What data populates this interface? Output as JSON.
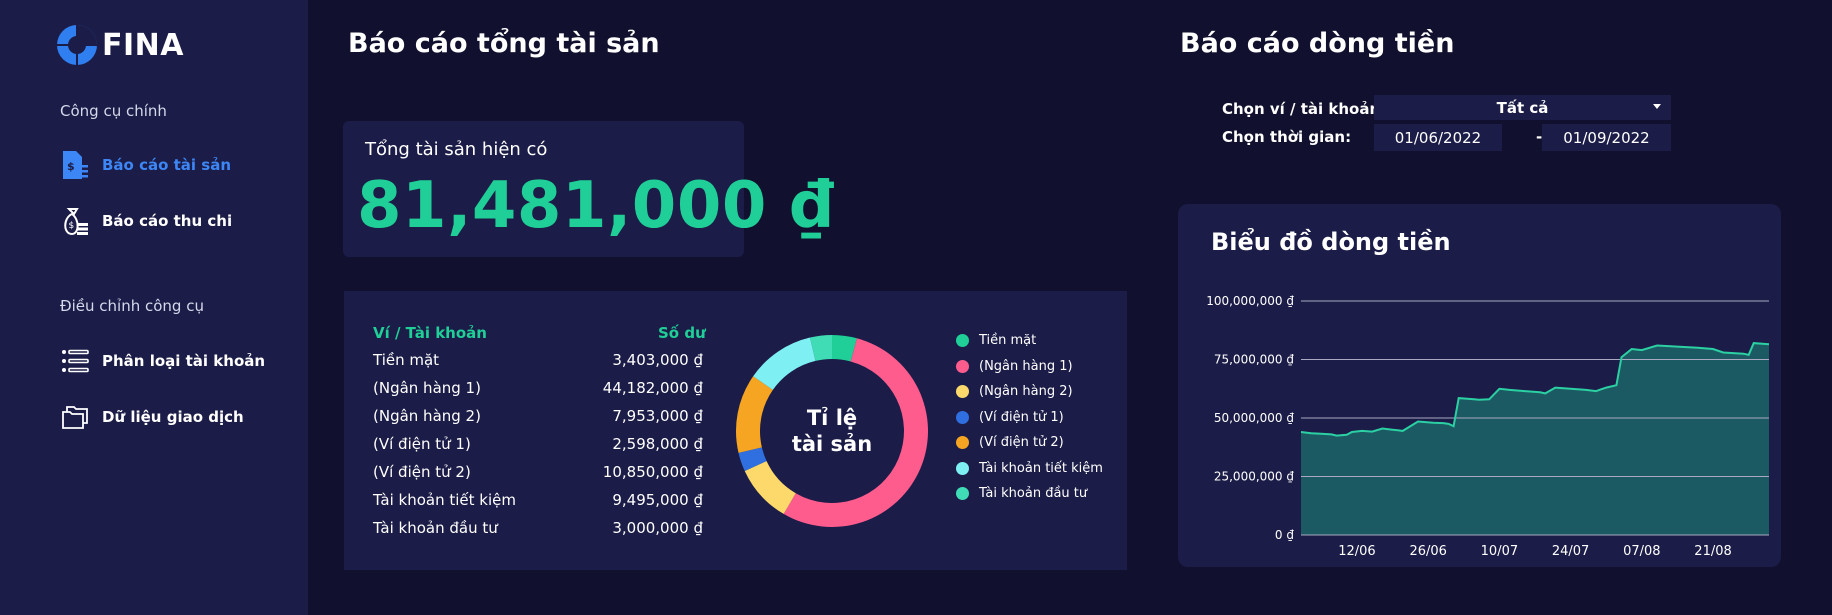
{
  "brand": {
    "name": "FINA",
    "logo_icon": "fina-logo-icon"
  },
  "sidebar": {
    "section_main": "Công cụ chính",
    "section_tools": "Điều chỉnh công cụ",
    "items": [
      {
        "label": "Báo cáo tài sản",
        "icon": "asset-report-icon",
        "active": true
      },
      {
        "label": "Báo cáo thu chi",
        "icon": "money-bag-icon",
        "active": false
      },
      {
        "label": "Phân loại tài khoản",
        "icon": "list-icon",
        "active": false
      },
      {
        "label": "Dữ liệu giao dịch",
        "icon": "folders-icon",
        "active": false
      }
    ]
  },
  "assets": {
    "title": "Báo cáo tổng tài sản",
    "total_label": "Tổng tài sản hiện có",
    "total_value": "81,481,000 ₫",
    "table": {
      "col_account": "Ví / Tài khoản",
      "col_balance": "Số dư",
      "rows": [
        {
          "name": "Tiền mặt",
          "balance": "3,403,000 ₫"
        },
        {
          "name": "(Ngân hàng 1)",
          "balance": "44,182,000 ₫"
        },
        {
          "name": "(Ngân hàng 2)",
          "balance": "7,953,000 ₫"
        },
        {
          "name": "(Ví điện tử 1)",
          "balance": "2,598,000 ₫"
        },
        {
          "name": "(Ví điện tử 2)",
          "balance": "10,850,000 ₫"
        },
        {
          "name": "Tài khoản tiết kiệm",
          "balance": "9,495,000 ₫"
        },
        {
          "name": "Tài khoản đầu tư",
          "balance": "3,000,000 ₫"
        }
      ]
    },
    "donut": {
      "center_line1": "Tỉ lệ",
      "center_line2": "tài sản",
      "slices": [
        {
          "label": "Tiền mặt",
          "value": 3403000,
          "color": "#1fcf97"
        },
        {
          "label": "(Ngân hàng 1)",
          "value": 44182000,
          "color": "#ff5c8e"
        },
        {
          "label": "(Ngân hàng 2)",
          "value": 7953000,
          "color": "#fcd96a"
        },
        {
          "label": "(Ví điện tử 1)",
          "value": 2598000,
          "color": "#2f6fe0"
        },
        {
          "label": "(Ví điện tử 2)",
          "value": 10850000,
          "color": "#f5a522"
        },
        {
          "label": "Tài khoản tiết kiệm",
          "value": 9495000,
          "color": "#7ef0f3"
        },
        {
          "label": "Tài khoản đầu tư",
          "value": 3000000,
          "color": "#40dcb5"
        }
      ]
    }
  },
  "cashflow": {
    "title": "Báo cáo dòng tiền",
    "wallet_label": "Chọn ví / tài khoản:",
    "wallet_value": "Tất cả",
    "time_label": "Chọn thời gian:",
    "date_from": "01/06/2022",
    "date_separator": "-",
    "date_to": "01/09/2022",
    "chart_title": "Biểu đồ dòng tiền"
  },
  "chart_data": {
    "type": "area",
    "title": "Biểu đồ dòng tiền",
    "ylim": [
      0,
      100000000
    ],
    "y_ticks": [
      0,
      25000000,
      50000000,
      75000000,
      100000000
    ],
    "y_tick_labels": [
      "0 ₫",
      "25,000,000 ₫",
      "50,000,000 ₫",
      "75,000,000 ₫",
      "100,000,000 ₫"
    ],
    "x_tick_labels": [
      "12/06",
      "26/06",
      "10/07",
      "24/07",
      "07/08",
      "21/08"
    ],
    "grid": true,
    "color": "#2bd0a3",
    "fill": "#1c5a63",
    "x": [
      "01/06",
      "03/06",
      "05/06",
      "07/06",
      "08/06",
      "10/06",
      "11/06",
      "13/06",
      "15/06",
      "17/06",
      "19/06",
      "20/06",
      "21/06",
      "24/06",
      "27/06",
      "29/06",
      "30/06",
      "01/07",
      "02/07",
      "05/07",
      "06/07",
      "08/07",
      "10/07",
      "12/07",
      "15/07",
      "18/07",
      "19/07",
      "21/07",
      "24/07",
      "27/07",
      "29/07",
      "31/07",
      "02/08",
      "03/08",
      "05/08",
      "07/08",
      "10/08",
      "14/08",
      "18/08",
      "21/08",
      "23/08",
      "27/08",
      "28/08",
      "29/08",
      "01/09"
    ],
    "values": [
      44000000,
      43500000,
      43300000,
      43000000,
      42500000,
      42800000,
      44000000,
      44500000,
      44200000,
      45500000,
      45000000,
      44800000,
      44500000,
      48500000,
      48000000,
      47800000,
      47500000,
      46500000,
      58500000,
      58000000,
      57800000,
      58000000,
      62500000,
      62000000,
      61500000,
      61000000,
      60500000,
      63000000,
      62500000,
      62000000,
      61500000,
      63000000,
      64000000,
      76000000,
      79500000,
      79000000,
      81000000,
      80500000,
      80000000,
      79500000,
      78000000,
      77500000,
      77000000,
      82000000,
      81500000
    ]
  }
}
